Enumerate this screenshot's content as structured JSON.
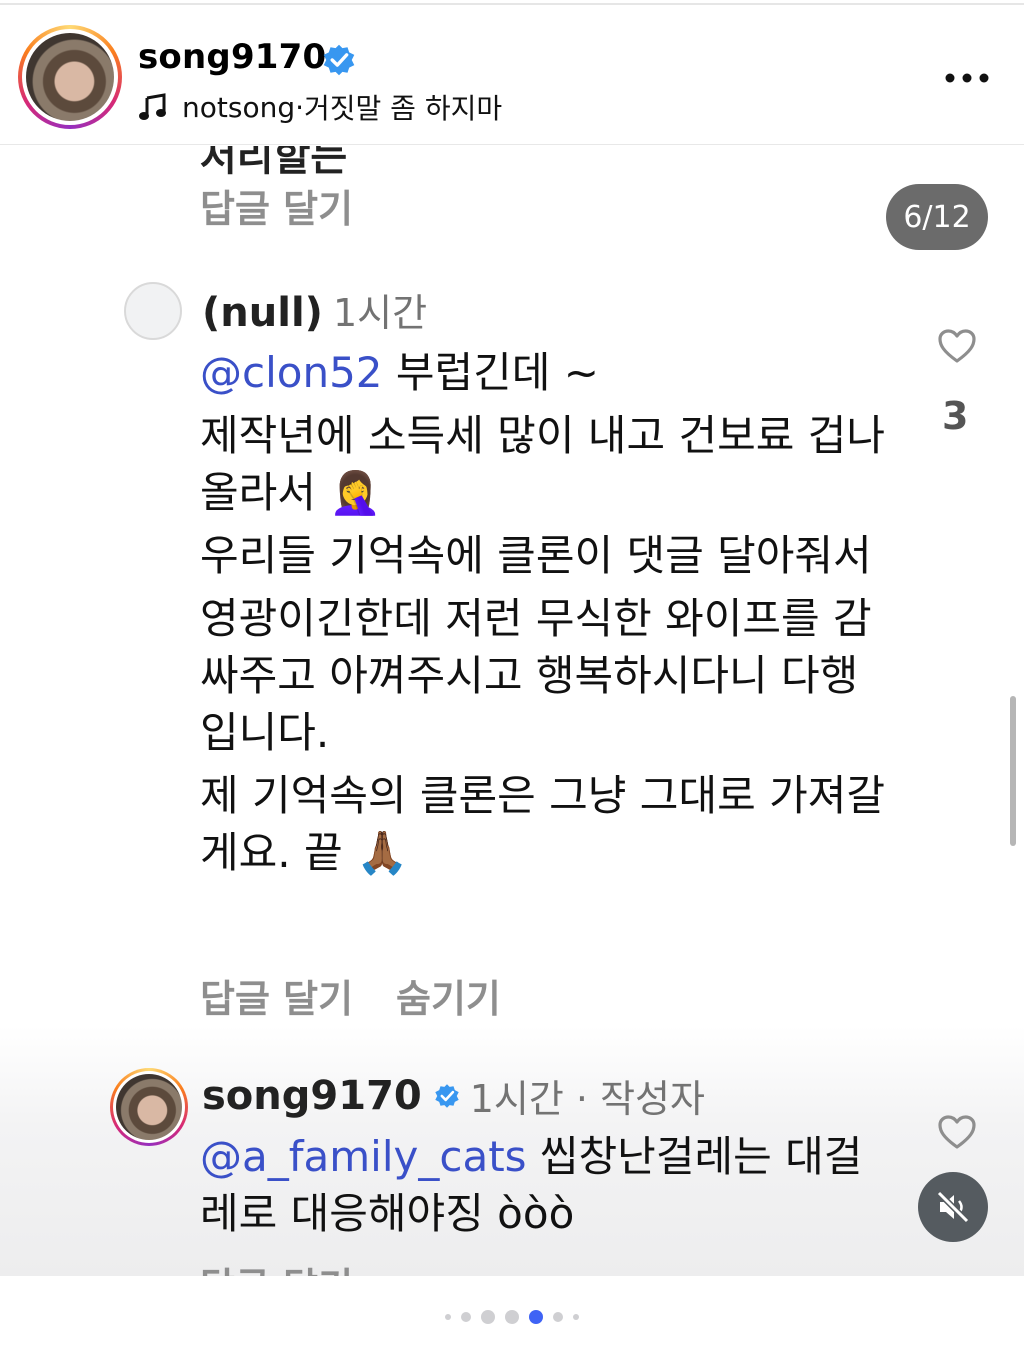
{
  "header": {
    "username": "song9170",
    "music_artist": "notsong",
    "music_separator": " · ",
    "music_title": "거짓말 좀 하지마"
  },
  "feed": {
    "cut_text": "저리할는",
    "page_indicator": "6/12",
    "comments": [
      {
        "user": "(null)",
        "time": "1시간",
        "mention": "@clon52",
        "lines": [
          " 부럽긴데 ~",
          "제작년에 소득세 많이 내고 건보료 겁나 올라서 🤦‍♀️",
          "우리들 기억속에 클론이 댓글 달아줘서",
          "영광이긴한데 저런 무식한 와이프를 감싸주고 아껴주시고 행복하시다니 다행입니다.",
          "제 기억속의 클론은 그냥 그대로 가져갈게요. 끝 🙏🏾"
        ],
        "likes": "3",
        "reply_label": "답글 달기",
        "hide_label": "숨기기"
      },
      {
        "user": "song9170",
        "time": "1시간 · 작성자",
        "mention": "@a_family_cats",
        "text": " 씹창난걸레는 대걸레로 대응해야징 ὸὸὸ",
        "reply_label": "답글 달기"
      }
    ],
    "top_reply_label": "답글 달기"
  },
  "carousel": {
    "dot_count": 7,
    "active_index": 4
  },
  "colors": {
    "mention": "#3a50c8",
    "active_dot": "#3f63f5",
    "verified": "#3897f0"
  },
  "icons": [
    "music-note-icon",
    "verified-badge-icon",
    "more-icon",
    "heart-icon",
    "mute-icon"
  ]
}
